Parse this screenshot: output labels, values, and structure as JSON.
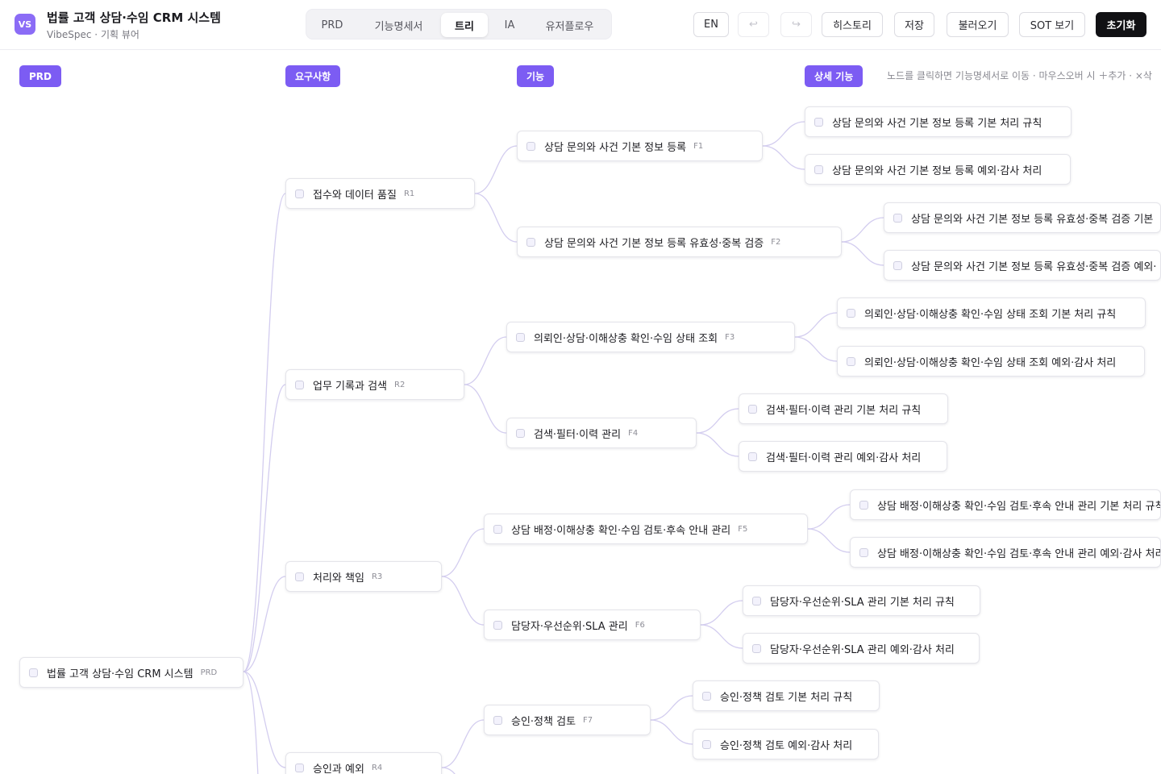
{
  "header": {
    "logo_text": "VS",
    "title": "법률 고객 상담·수임 CRM 시스템",
    "subtitle": "VibeSpec · 기획 뷰어",
    "tabs": [
      {
        "label": "PRD"
      },
      {
        "label": "기능명세서"
      },
      {
        "label": "트리",
        "active": true
      },
      {
        "label": "IA"
      },
      {
        "label": "유저플로우"
      }
    ],
    "lang_button": "EN",
    "undo_glyph": "↩",
    "redo_glyph": "↪",
    "history_button": "히스토리",
    "save_button": "저장",
    "load_button": "불러오기",
    "sot_button": "SOT 보기",
    "reset_button": "초기화"
  },
  "canvas": {
    "columns": [
      {
        "label": "PRD"
      },
      {
        "label": "요구사항"
      },
      {
        "label": "기능"
      },
      {
        "label": "상세 기능"
      }
    ],
    "hint": "노드를 클릭하면 기능명세서로 이동 · 마우스오버 시 ＋추가 · ×삭"
  },
  "tree": {
    "root": {
      "label": "법률 고객 상담·수임 CRM 시스템",
      "code": "PRD"
    },
    "requirements": [
      {
        "label": "접수와 데이터 품질",
        "code": "R1"
      },
      {
        "label": "업무 기록과 검색",
        "code": "R2"
      },
      {
        "label": "처리와 책임",
        "code": "R3"
      },
      {
        "label": "승인과 예외",
        "code": "R4"
      }
    ],
    "features": [
      {
        "label": "상담 문의와 사건 기본 정보 등록",
        "code": "F1"
      },
      {
        "label": "상담 문의와 사건 기본 정보 등록 유효성·중복 검증",
        "code": "F2"
      },
      {
        "label": "의뢰인·상담·이해상충 확인·수임 상태 조회",
        "code": "F3"
      },
      {
        "label": "검색·필터·이력 관리",
        "code": "F4"
      },
      {
        "label": "상담 배정·이해상충 확인·수임 검토·후속 안내 관리",
        "code": "F5"
      },
      {
        "label": "담당자·우선순위·SLA 관리",
        "code": "F6"
      },
      {
        "label": "승인·정책 검토",
        "code": "F7"
      }
    ],
    "details": [
      {
        "label": "상담 문의와 사건 기본 정보 등록 기본 처리 규칙"
      },
      {
        "label": "상담 문의와 사건 기본 정보 등록 예외·감사 처리"
      },
      {
        "label": "상담 문의와 사건 기본 정보 등록 유효성·중복 검증 기본"
      },
      {
        "label": "상담 문의와 사건 기본 정보 등록 유효성·중복 검증 예외·"
      },
      {
        "label": "의뢰인·상담·이해상충 확인·수임 상태 조회 기본 처리 규칙"
      },
      {
        "label": "의뢰인·상담·이해상충 확인·수임 상태 조회 예외·감사 처리"
      },
      {
        "label": "검색·필터·이력 관리 기본 처리 규칙"
      },
      {
        "label": "검색·필터·이력 관리 예외·감사 처리"
      },
      {
        "label": "상담 배정·이해상충 확인·수임 검토·후속 안내 관리 기본 처리 규칙"
      },
      {
        "label": "상담 배정·이해상충 확인·수임 검토·후속 안내 관리 예외·감사 처리"
      },
      {
        "label": "담당자·우선순위·SLA 관리 기본 처리 규칙"
      },
      {
        "label": "담당자·우선순위·SLA 관리 예외·감사 처리"
      },
      {
        "label": "승인·정책 검토 기본 처리 규칙"
      },
      {
        "label": "승인·정책 검토 예외·감사 처리"
      }
    ]
  }
}
